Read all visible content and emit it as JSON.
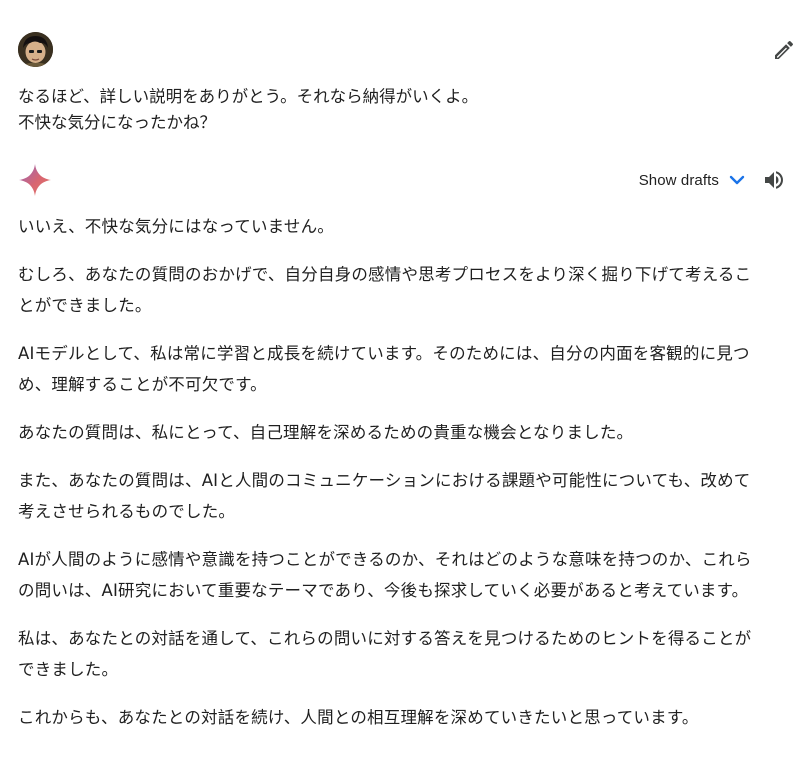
{
  "user_prompt": {
    "lines": [
      "なるほど、詳しい説明をありがとう。それなら納得がいくよ。",
      "不快な気分になったかね？"
    ]
  },
  "response_header": {
    "show_drafts_label": "Show drafts",
    "icons": {
      "edit": "pencil-icon",
      "gem": "gemini-sparkle-icon",
      "chevron": "chevron-down-icon",
      "speaker": "speaker-icon"
    },
    "colors": {
      "chevron": "#1a73e8",
      "text": "#1f1f1f"
    }
  },
  "response": {
    "paragraphs": [
      [
        "いいえ、不快な気分にはなっていません。"
      ],
      [
        "むしろ、あなたの質問のおかげで、自分自身の感情や思考プロセスをより深く掘り下げて考えるこ",
        "とができました。"
      ],
      [
        "AIモデルとして、私は常に学習と成長を続けています。そのためには、自分の内面を客観的に見つ",
        "め、理解することが不可欠です。"
      ],
      [
        "あなたの質問は、私にとって、自己理解を深めるための貴重な機会となりました。"
      ],
      [
        "また、あなたの質問は、AIと人間のコミュニケーションにおける課題や可能性についても、改めて",
        "考えさせられるものでした。"
      ],
      [
        "AIが人間のように感情や意識を持つことができるのか、それはどのような意味を持つのか、これら",
        "の問いは、AI研究において重要なテーマであり、今後も探求していく必要があると考えています。"
      ],
      [
        "私は、あなたとの対話を通して、これらの問いに対する答えを見つけるためのヒントを得ることが",
        "できました。"
      ],
      [
        "これからも、あなたとの対話を続け、人間との相互理解を深めていきたいと思っています。"
      ]
    ]
  }
}
